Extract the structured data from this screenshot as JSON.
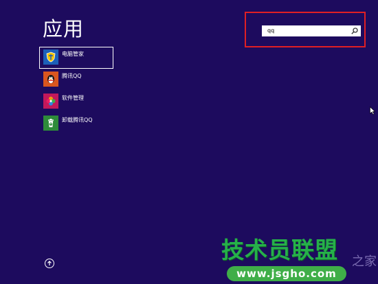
{
  "page": {
    "title": "应用"
  },
  "apps": [
    {
      "label": "电脑管家",
      "icon": "shield-icon",
      "color": "#1c5fb8",
      "selected": true
    },
    {
      "label": "腾讯QQ",
      "icon": "penguin-icon",
      "color": "#d9561f",
      "selected": false
    },
    {
      "label": "软件管理",
      "icon": "clover-icon",
      "color": "#c2185b",
      "selected": false
    },
    {
      "label": "卸载腾讯QQ",
      "icon": "recycle-bin-icon",
      "color": "#2e8b3a",
      "selected": false
    }
  ],
  "search": {
    "value": "qq",
    "icon": "search-icon",
    "highlight_color": "#e01f24"
  },
  "watermark": {
    "title": "技术员联盟",
    "url": "www.jsgho.com",
    "tail": "之家"
  },
  "colors": {
    "background": "#1d0b5e",
    "watermark_green": "#26b04a"
  }
}
